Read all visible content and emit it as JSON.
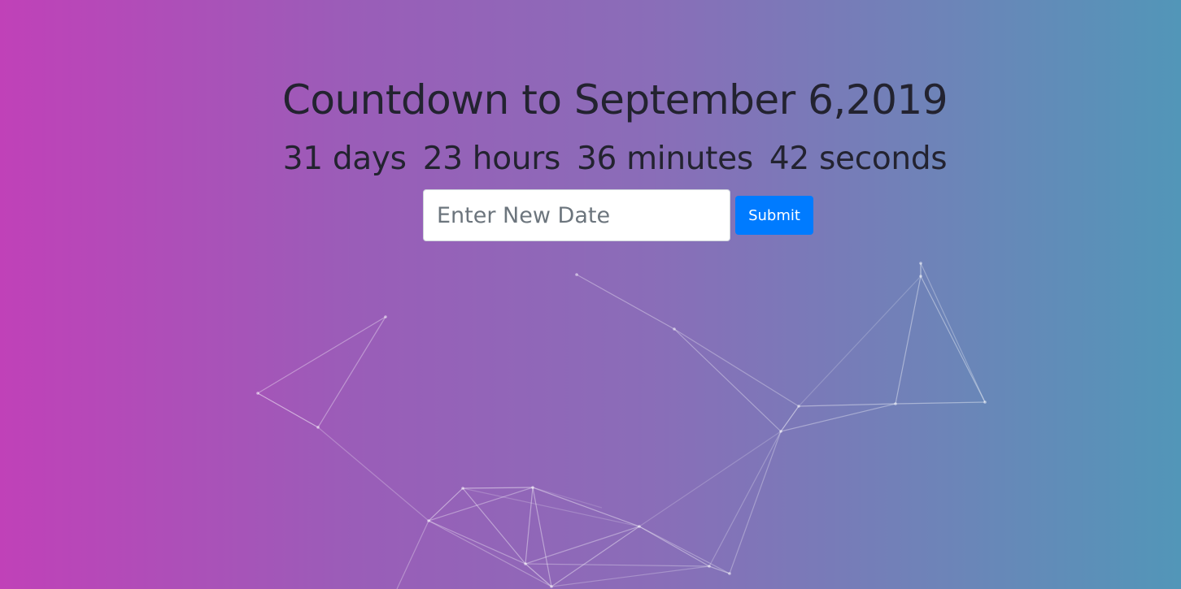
{
  "page": {
    "title": "Countdown to September 6,2019"
  },
  "countdown": {
    "days": "31 days",
    "hours": "23 hours",
    "minutes": "36 minutes",
    "seconds": "42 seconds"
  },
  "form": {
    "date_placeholder": "Enter New Date",
    "date_value": "",
    "submit_label": "Submit"
  },
  "colors": {
    "gradient_start": "#c041b8",
    "gradient_end": "#5296b8",
    "button": "#007bff",
    "network_line": "#ffffff"
  }
}
